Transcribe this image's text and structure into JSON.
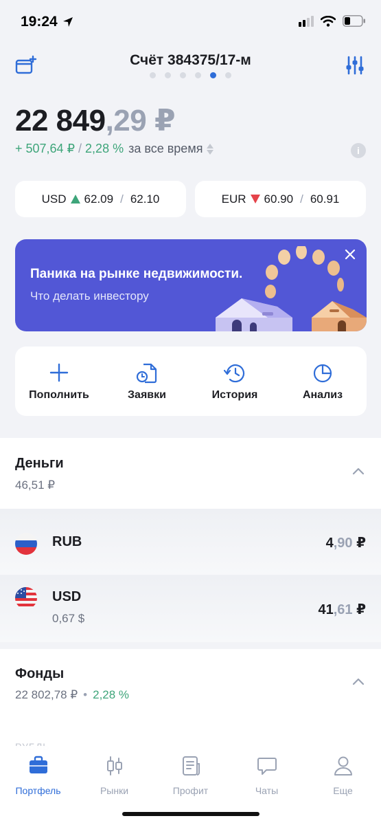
{
  "status_bar": {
    "time": "19:24"
  },
  "header": {
    "title": "Счёт 384375/17-м",
    "pages": 6,
    "active_page": 5,
    "icons": {
      "left": "add-wallet-icon",
      "right": "settings-sliders-icon"
    }
  },
  "balance": {
    "integer": "22 849",
    "fraction": ",29 ₽",
    "change_amount": "+ 507,64 ₽",
    "separator": "/",
    "change_percent": "2,28 %",
    "period": "за все время"
  },
  "fx": [
    {
      "currency": "USD",
      "direction": "up",
      "bid": "62.09",
      "separator": "/",
      "ask": "62.10"
    },
    {
      "currency": "EUR",
      "direction": "down",
      "bid": "60.90",
      "separator": "/",
      "ask": "60.91"
    }
  ],
  "banner": {
    "title": "Паника на рынке недвижимости.",
    "subtitle": "Что делать инвестору"
  },
  "actions": [
    {
      "label": "Пополнить",
      "icon": "plus-icon"
    },
    {
      "label": "Заявки",
      "icon": "orders-icon"
    },
    {
      "label": "История",
      "icon": "history-icon"
    },
    {
      "label": "Анализ",
      "icon": "pie-chart-icon"
    }
  ],
  "money": {
    "title": "Деньги",
    "total": "46,51 ₽",
    "rows": [
      {
        "code": "RUB",
        "sub": "",
        "value_int": "4",
        "value_frac": ",90",
        "value_cur": " ₽"
      },
      {
        "code": "USD",
        "sub": "0,67 $",
        "value_int": "41",
        "value_frac": ",61",
        "value_cur": " ₽"
      }
    ]
  },
  "funds": {
    "title": "Фонды",
    "total": "22 802,78 ₽",
    "dot": "•",
    "percent": "2,28 %",
    "cutoff_label": "РУБЛЬ"
  },
  "tabs": [
    {
      "label": "Портфель",
      "icon": "briefcase-icon",
      "active": true
    },
    {
      "label": "Рынки",
      "icon": "candles-icon",
      "active": false
    },
    {
      "label": "Профит",
      "icon": "news-icon",
      "active": false
    },
    {
      "label": "Чаты",
      "icon": "chat-icon",
      "active": false
    },
    {
      "label": "Еще",
      "icon": "profile-icon",
      "active": false
    }
  ],
  "colors": {
    "accent": "#2f6dd8",
    "positive": "#3ea57a",
    "negative": "#e5434a",
    "banner": "#5257d6"
  }
}
